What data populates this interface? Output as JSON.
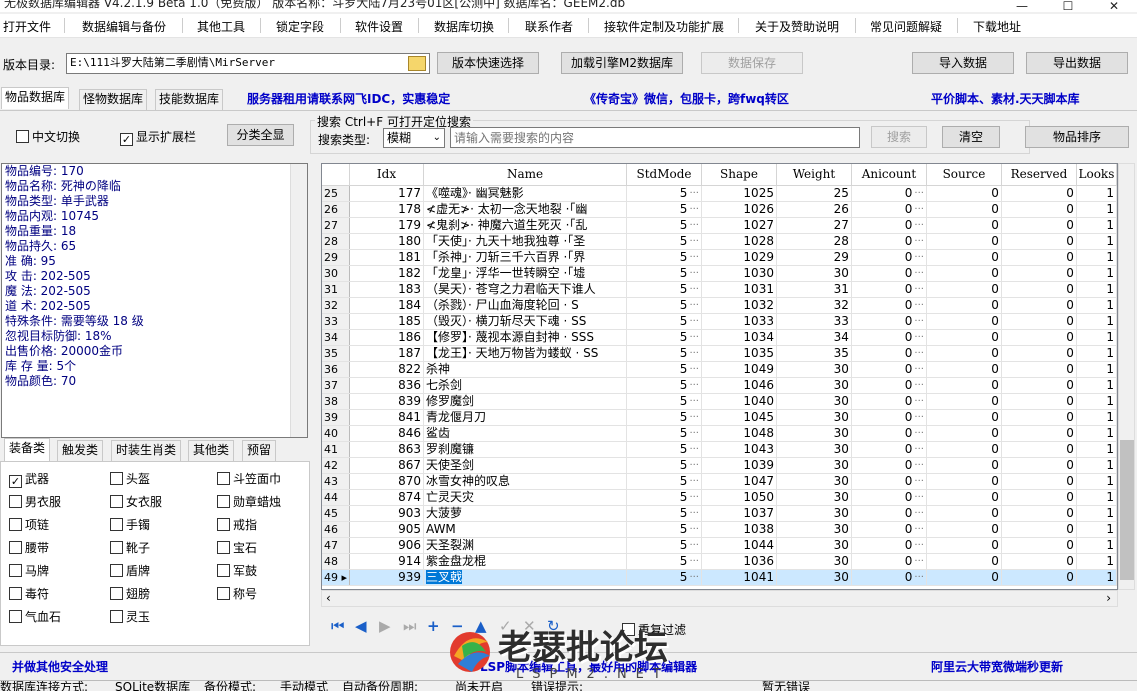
{
  "title": {
    "text": "无极数据库编辑器 V4.2.1.9   Beta 1.0（免费版）       版本名称：斗罗大陆7月23号01区[公测中]      数据库名：GEEM2.db",
    "controls": [
      "—",
      "☐",
      "✕"
    ]
  },
  "menu": [
    "打开文件",
    "数据编辑与备份",
    "其他工具",
    "锁定字段",
    "软件设置",
    "数据库切换",
    "联系作者",
    "接软件定制及功能扩展",
    "关于及赞助说明",
    "常见问题解疑",
    "下载地址"
  ],
  "toolbar": {
    "version_dir_label": "版本目录:",
    "version_dir_value": "E:\\111斗罗大陆第二季剧情\\MirServer",
    "quick_select": "版本快速选择",
    "load_engine": "加载引擎M2数据库",
    "save_data": "数据保存",
    "import_data": "导入数据",
    "export_data": "导出数据"
  },
  "tabs": [
    "物品数据库",
    "怪物数据库",
    "技能数据库"
  ],
  "ads": {
    "ad1": "服务器租用请联系网飞IDC，实惠稳定",
    "ad2": "《传奇宝》微信，包服卡，跨fwq转区",
    "ad3": "平价脚本、素材.天天脚本库",
    "bottom_left": "并做其他安全处理",
    "bottom_mid": "LSP脚本编辑工具，最好用的脚本编辑器",
    "bottom_right": "阿里云大带宽微端秒更新"
  },
  "options": {
    "chinese_switch": "中文切换",
    "show_ext": "显示扩展栏",
    "show_all": "分类全显",
    "search_title": "搜索  Ctrl+F 可打开定位搜索",
    "search_type_label": "搜索类型:",
    "search_type_value": "模糊",
    "search_placeholder": "请输入需要搜索的内容",
    "search_btn": "搜索",
    "clear_btn": "清空",
    "sort_btn": "物品排序"
  },
  "info": [
    "物品编号: 170",
    "物品名称: 死神の降临",
    "物品类型: 单手武器",
    "物品内观: 10745",
    "物品重量: 18",
    "物品持久: 65",
    "准    确: 95",
    "攻    击: 202-505",
    "魔    法: 202-505",
    "道    术: 202-505",
    "特殊条件: 需要等级 18 级",
    "忽视目标防御: 18%",
    "出售价格: 20000金币",
    "库 存 量: 5个",
    "物品颜色: 70"
  ],
  "category_tabs": [
    "装备类",
    "触发类",
    "时装生肖类",
    "其他类",
    "预留"
  ],
  "categories": [
    {
      "label": "武器",
      "checked": true
    },
    {
      "label": "头盔",
      "checked": false
    },
    {
      "label": "斗笠面巾",
      "checked": false
    },
    {
      "label": "男衣服",
      "checked": false
    },
    {
      "label": "女衣服",
      "checked": false
    },
    {
      "label": "勋章蜡烛",
      "checked": false
    },
    {
      "label": "项链",
      "checked": false
    },
    {
      "label": "手镯",
      "checked": false
    },
    {
      "label": "戒指",
      "checked": false
    },
    {
      "label": "腰带",
      "checked": false
    },
    {
      "label": "靴子",
      "checked": false
    },
    {
      "label": "宝石",
      "checked": false
    },
    {
      "label": "马牌",
      "checked": false
    },
    {
      "label": "盾牌",
      "checked": false
    },
    {
      "label": "军鼓",
      "checked": false
    },
    {
      "label": "毒符",
      "checked": false
    },
    {
      "label": "翅膀",
      "checked": false
    },
    {
      "label": "称号",
      "checked": false
    },
    {
      "label": "气血石",
      "checked": false
    },
    {
      "label": "灵玉",
      "checked": false
    }
  ],
  "grid": {
    "columns": [
      "Idx",
      "Name",
      "StdMode",
      "Shape",
      "Weight",
      "Anicount",
      "Source",
      "Reserved",
      "Looks"
    ],
    "rows": [
      [
        "25",
        "177",
        "《噬魂》· 幽冥魅影",
        "5",
        "1025",
        "25",
        "0",
        "0",
        "0",
        "1"
      ],
      [
        "26",
        "178",
        "≮虚无≯· 太初一念天地裂 ·「幽",
        "5",
        "1026",
        "26",
        "0",
        "0",
        "0",
        "1"
      ],
      [
        "27",
        "179",
        "≮鬼刹≯· 神魔六道生死灭 ·「乱",
        "5",
        "1027",
        "27",
        "0",
        "0",
        "0",
        "1"
      ],
      [
        "28",
        "180",
        "「天使」· 九天十地我独尊 ·「圣",
        "5",
        "1028",
        "28",
        "0",
        "0",
        "0",
        "1"
      ],
      [
        "29",
        "181",
        "「杀神」· 刀斩三千六百界 ·「界",
        "5",
        "1029",
        "29",
        "0",
        "0",
        "0",
        "1"
      ],
      [
        "30",
        "182",
        "「龙皇」· 浮华一世转瞬空 ·「墟",
        "5",
        "1030",
        "30",
        "0",
        "0",
        "0",
        "1"
      ],
      [
        "31",
        "183",
        "（昊天）· 苍穹之力君临天下谁人",
        "5",
        "1031",
        "31",
        "0",
        "0",
        "0",
        "1"
      ],
      [
        "32",
        "184",
        "（杀戮）· 尸山血海度轮回 · S",
        "5",
        "1032",
        "32",
        "0",
        "0",
        "0",
        "1"
      ],
      [
        "33",
        "185",
        "（毁灭）· 横刀斩尽天下魂 · SS",
        "5",
        "1033",
        "33",
        "0",
        "0",
        "0",
        "1"
      ],
      [
        "34",
        "186",
        "【修罗】· 蔑视本源自封神 · SSS",
        "5",
        "1034",
        "34",
        "0",
        "0",
        "0",
        "1"
      ],
      [
        "35",
        "187",
        "【龙王】· 天地万物皆为蝼蚁 · SS",
        "5",
        "1035",
        "35",
        "0",
        "0",
        "0",
        "1"
      ],
      [
        "36",
        "822",
        "杀神",
        "5",
        "1049",
        "30",
        "0",
        "0",
        "0",
        "1"
      ],
      [
        "37",
        "836",
        "七杀剑",
        "5",
        "1046",
        "30",
        "0",
        "0",
        "0",
        "1"
      ],
      [
        "38",
        "839",
        "修罗魔剑",
        "5",
        "1040",
        "30",
        "0",
        "0",
        "0",
        "1"
      ],
      [
        "39",
        "841",
        "青龙偃月刀",
        "5",
        "1045",
        "30",
        "0",
        "0",
        "0",
        "1"
      ],
      [
        "40",
        "846",
        "鲨齿",
        "5",
        "1048",
        "30",
        "0",
        "0",
        "0",
        "1"
      ],
      [
        "41",
        "863",
        "罗刹魔镰",
        "5",
        "1043",
        "30",
        "0",
        "0",
        "0",
        "1"
      ],
      [
        "42",
        "867",
        "天使圣剑",
        "5",
        "1039",
        "30",
        "0",
        "0",
        "0",
        "1"
      ],
      [
        "43",
        "870",
        "冰雪女神的叹息",
        "5",
        "1047",
        "30",
        "0",
        "0",
        "0",
        "1"
      ],
      [
        "44",
        "874",
        "亡灵天灾",
        "5",
        "1050",
        "30",
        "0",
        "0",
        "0",
        "1"
      ],
      [
        "45",
        "903",
        "大菠萝",
        "5",
        "1037",
        "30",
        "0",
        "0",
        "0",
        "1"
      ],
      [
        "46",
        "905",
        "AWM",
        "5",
        "1038",
        "30",
        "0",
        "0",
        "0",
        "1"
      ],
      [
        "47",
        "906",
        "天圣裂渊",
        "5",
        "1044",
        "30",
        "0",
        "0",
        "0",
        "1"
      ],
      [
        "48",
        "914",
        "紫金盘龙棍",
        "5",
        "1036",
        "30",
        "0",
        "0",
        "0",
        "1"
      ],
      [
        "49",
        "939",
        "三叉戟",
        "5",
        "1041",
        "30",
        "0",
        "0",
        "0",
        "1"
      ]
    ]
  },
  "nav": {
    "repeat_filter": "重复过滤"
  },
  "status": [
    "数据库连接方式:",
    "SQLite数据库",
    "备份模式:",
    "手动模式",
    "自动备份周期:",
    "尚未开启",
    "错误提示:",
    "暂无错误"
  ],
  "logo": {
    "main": "老瑟批论坛",
    "sub": "LSPM2.NET"
  }
}
